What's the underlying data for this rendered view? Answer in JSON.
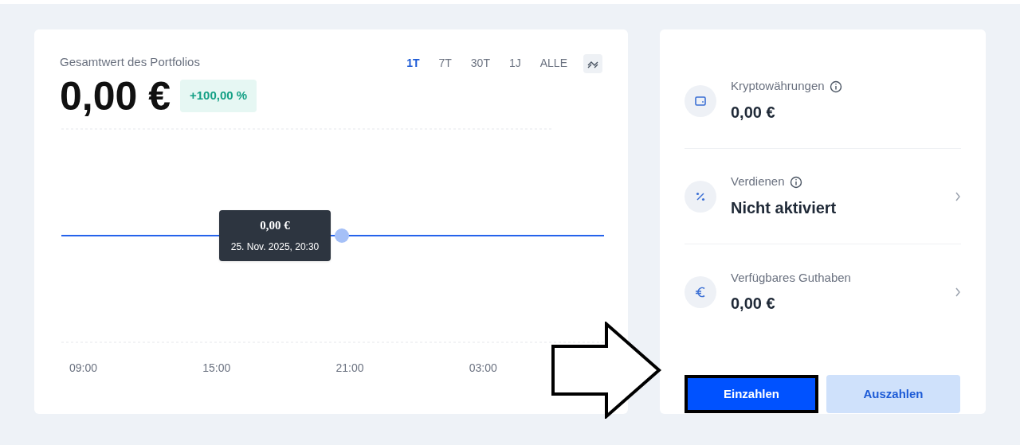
{
  "portfolio": {
    "title": "Gesamtwert des Portfolios",
    "value": "0,00 €",
    "change": "+100,00 %",
    "ranges": [
      {
        "label": "1T",
        "selected": true
      },
      {
        "label": "7T",
        "selected": false
      },
      {
        "label": "30T",
        "selected": false
      },
      {
        "label": "1J",
        "selected": false
      },
      {
        "label": "ALLE",
        "selected": false
      }
    ],
    "tooltip": {
      "value": "0,00 €",
      "date": "25. Nov. 2025, 20:30"
    },
    "x_labels": [
      "09:00",
      "15:00",
      "21:00",
      "03:00"
    ]
  },
  "summary": {
    "rows": [
      {
        "kind": "wallet",
        "label": "Kryptowährungen",
        "info": true,
        "value": "0,00 €",
        "chevron": false
      },
      {
        "kind": "percent",
        "label": "Verdienen",
        "info": true,
        "value": "Nicht aktiviert",
        "chevron": true
      },
      {
        "kind": "euro",
        "label": "Verfügbares Guthaben",
        "info": false,
        "value": "0,00 €",
        "chevron": true
      }
    ],
    "buttons": [
      {
        "kind": "primary",
        "label": "Einzahlen",
        "highlighted": true
      },
      {
        "kind": "secondary",
        "label": "Auszahlen",
        "highlighted": false
      }
    ]
  },
  "annotation": {
    "kind": "arrow"
  }
}
